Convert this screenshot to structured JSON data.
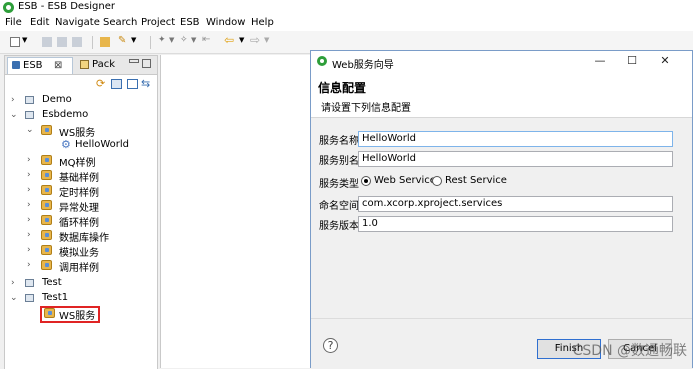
{
  "window": {
    "title": "ESB - ESB Designer"
  },
  "menu": {
    "items": [
      "File",
      "Edit",
      "Navigate",
      "Search",
      "Project",
      "ESB",
      "Window",
      "Help"
    ]
  },
  "toolbar": {
    "icons": [
      "new-icon",
      "save-icon",
      "save-all-icon",
      "print-icon",
      "open-folder-icon",
      "wand-icon",
      "edit-icon",
      "pin-icon",
      "back-icon",
      "forward-icon"
    ]
  },
  "left_panel": {
    "tabs": [
      {
        "label": "ESB",
        "close": "⊠"
      },
      {
        "label": "Pack"
      }
    ],
    "tree": [
      {
        "label": "Demo"
      },
      {
        "label": "Esbdemo"
      },
      {
        "label": "WS服务"
      },
      {
        "label": "HelloWorld"
      },
      {
        "label": "MQ样例"
      },
      {
        "label": "基础样例"
      },
      {
        "label": "定时样例"
      },
      {
        "label": "异常处理"
      },
      {
        "label": "循环样例"
      },
      {
        "label": "数据库操作"
      },
      {
        "label": "模拟业务"
      },
      {
        "label": "调用样例"
      },
      {
        "label": "Test"
      },
      {
        "label": "Test1"
      },
      {
        "label": "WS服务"
      }
    ]
  },
  "dialog": {
    "title": "Web服务向导",
    "heading": "信息配置",
    "description": "请设置下列信息配置",
    "fields": {
      "service_name": {
        "label": "服务名称",
        "value": "HelloWorld"
      },
      "service_alias": {
        "label": "服务别名",
        "value": "HelloWorld"
      },
      "service_type": {
        "label": "服务类型",
        "options": [
          "Web Service",
          "Rest Service"
        ],
        "selected": "Web Service"
      },
      "namespace": {
        "label": "命名空间",
        "value": "com.xcorp.xproject.services"
      },
      "version": {
        "label": "服务版本",
        "value": "1.0"
      }
    },
    "help": "?",
    "buttons": {
      "finish": "Finish",
      "cancel": "Cancel"
    }
  },
  "watermark": "CSDN @数通畅联"
}
